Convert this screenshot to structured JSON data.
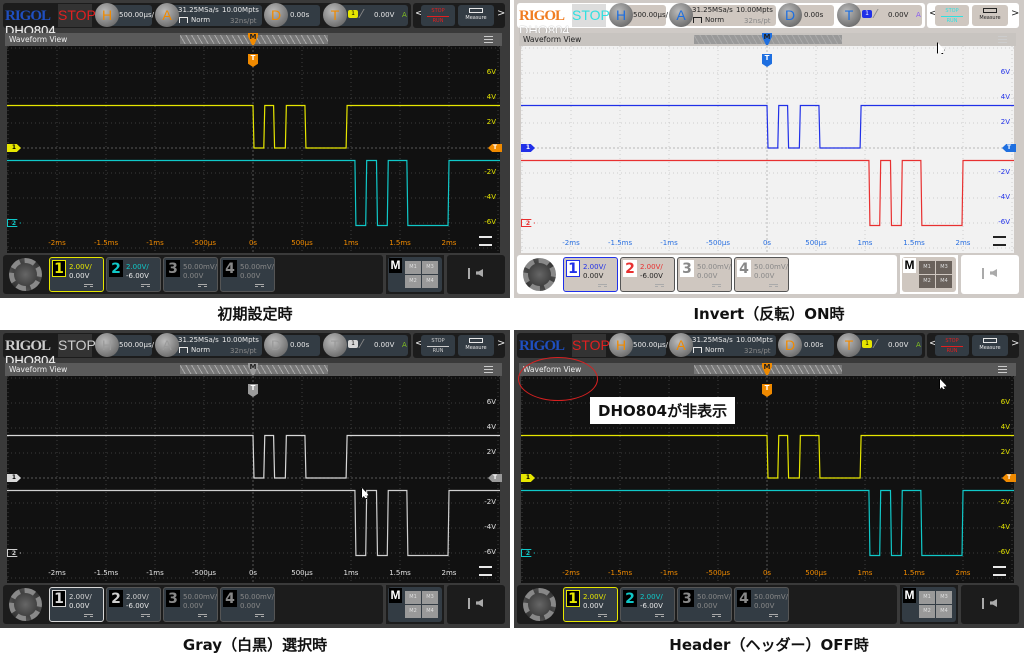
{
  "captions": [
    "初期設定時",
    "Invert（反転）ON時",
    "Gray（白黒）選択時",
    "Header（ヘッダー）OFF時"
  ],
  "annotation": {
    "text": "DHO804が非表示",
    "ring_color": "#d62020"
  },
  "scope": {
    "logo": "RIGOL",
    "model": "DHO804",
    "run_state": "STOP",
    "horizontal": {
      "icon": "H",
      "scale": "500.00µs/"
    },
    "acquire": {
      "icon": "A",
      "sample_rate": "31.25MSa/s",
      "memory": "10.00Mpts",
      "mode": "Norm",
      "resolution": "32ns/pt"
    },
    "delay": {
      "icon": "D",
      "value": "0.00s"
    },
    "trigger": {
      "icon": "T",
      "source": "1",
      "level": "0.00V",
      "sweep": "A",
      "marker": "T"
    },
    "stop_run": [
      "STOP",
      "RUN"
    ],
    "measure": "Measure",
    "nav_left": "<",
    "nav_right": ">",
    "view_title": "Waveform View",
    "center_marker": "M",
    "volt_labels": [
      "6V",
      "4V",
      "2V",
      "-2V",
      "-4V",
      "-6V"
    ],
    "volt_values": [
      6,
      4,
      2,
      -2,
      -4,
      -6
    ],
    "time_labels": [
      "-2ms",
      "-1.5ms",
      "-1ms",
      "-500µs",
      "0s",
      "500µs",
      "1ms",
      "1.5ms",
      "2ms"
    ],
    "time_values_ms": [
      -2,
      -1.5,
      -1,
      -0.5,
      0,
      0.5,
      1,
      1.5,
      2
    ],
    "channels": [
      {
        "num": "1",
        "scale": "2.00V/",
        "offset": "0.00V",
        "active": true
      },
      {
        "num": "2",
        "scale": "2.00V/",
        "offset": "-6.00V",
        "active": true
      },
      {
        "num": "3",
        "scale": "50.00mV/",
        "offset": "0.00V",
        "active": false
      },
      {
        "num": "4",
        "scale": "50.00mV/",
        "offset": "0.00V",
        "active": false
      }
    ],
    "math": {
      "label": "M",
      "slots": [
        "M1",
        "M3",
        "M2",
        "M4"
      ]
    },
    "status_icons": [
      "usb-icon",
      "speaker-muted-icon"
    ],
    "waveforms": {
      "ch1": {
        "high_v": 3.4,
        "low_v": 0,
        "start": "high",
        "edges_ms": [
          0,
          0.11,
          0.21,
          0.33,
          0.53,
          0.95
        ]
      },
      "ch2": {
        "high_v": -1.0,
        "low_v": -6.2,
        "start": "high",
        "edges_ms": [
          1.04,
          1.15,
          1.26,
          1.37,
          1.57,
          1.99
        ]
      }
    }
  },
  "themes": [
    {
      "id": "default",
      "show_model": true,
      "bg": "#3a3a3a",
      "bar": "#1c1c1c",
      "plot": "#111111",
      "grid": "#4a4a4a",
      "view": "#5a5a5a",
      "text": "#e8e8e8",
      "logo": "#1f4fc0",
      "stop": "#e02020",
      "accent": "#f08a00",
      "ch1": "#e6e600",
      "ch2": "#10c8c8",
      "time_label": "#f08a00",
      "volt_label": "#e6e600",
      "box": "#333c44"
    },
    {
      "id": "invert",
      "show_model": true,
      "bg": "#cfcac6",
      "bar": "#ffffff",
      "plot": "#f2f2f2",
      "grid": "#c4c4c4",
      "view": "#c8c4c0",
      "text": "#222222",
      "logo": "#f07c20",
      "stop": "#30e0e0",
      "accent": "#1e6fe0",
      "ch1": "#2030e8",
      "ch2": "#e83030",
      "time_label": "#2a70e0",
      "volt_label": "#2030e8",
      "box": "#cfc7c0"
    },
    {
      "id": "gray",
      "show_model": true,
      "bg": "#3a3a3a",
      "bar": "#1c1c1c",
      "plot": "#111111",
      "grid": "#4a4a4a",
      "view": "#5a5a5a",
      "text": "#e8e8e8",
      "logo": "#cccccc",
      "stop": "#cccccc",
      "accent": "#9a9a9a",
      "ch1": "#d8d8d8",
      "ch2": "#cfcfcf",
      "time_label": "#e0e0e0",
      "volt_label": "#e0e0e0",
      "box": "#333c44"
    },
    {
      "id": "header-off",
      "show_model": false,
      "bg": "#3a3a3a",
      "bar": "#1c1c1c",
      "plot": "#111111",
      "grid": "#4a4a4a",
      "view": "#5a5a5a",
      "text": "#e8e8e8",
      "logo": "#1f4fc0",
      "stop": "#e02020",
      "accent": "#f08a00",
      "ch1": "#e6e600",
      "ch2": "#10c8c8",
      "time_label": "#f08a00",
      "volt_label": "#e6e600",
      "box": "#333c44"
    }
  ]
}
